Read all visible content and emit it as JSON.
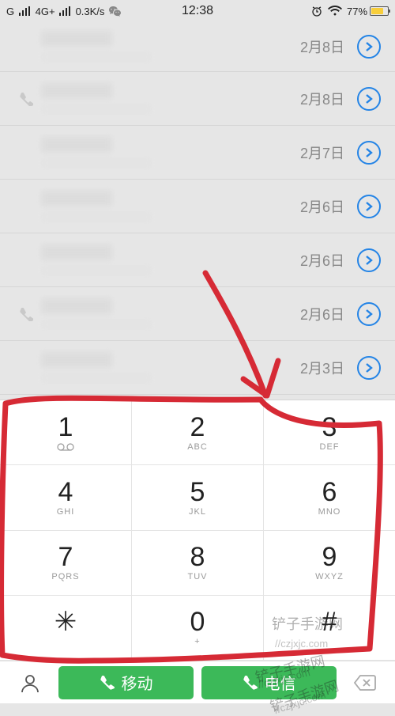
{
  "status": {
    "network": "G",
    "signal": "4G+",
    "speed": "0.3K/s",
    "time": "12:38",
    "battery_pct": "77%"
  },
  "calls": [
    {
      "date": "2月8日",
      "icon": "none"
    },
    {
      "date": "2月8日",
      "icon": "outgoing"
    },
    {
      "date": "2月7日",
      "icon": "none"
    },
    {
      "date": "2月6日",
      "icon": "none"
    },
    {
      "date": "2月6日",
      "icon": "none"
    },
    {
      "date": "2月6日",
      "icon": "outgoing"
    },
    {
      "date": "2月3日",
      "icon": "none"
    }
  ],
  "dialpad": [
    [
      {
        "num": "1",
        "sub": "voicemail"
      },
      {
        "num": "2",
        "sub": "ABC"
      },
      {
        "num": "3",
        "sub": "DEF"
      }
    ],
    [
      {
        "num": "4",
        "sub": "GHI"
      },
      {
        "num": "5",
        "sub": "JKL"
      },
      {
        "num": "6",
        "sub": "MNO"
      }
    ],
    [
      {
        "num": "7",
        "sub": "PQRS"
      },
      {
        "num": "8",
        "sub": "TUV"
      },
      {
        "num": "9",
        "sub": "WXYZ"
      }
    ],
    [
      {
        "num": "✳",
        "sub": ""
      },
      {
        "num": "0",
        "sub": "+"
      },
      {
        "num": "#",
        "sub": ""
      }
    ]
  ],
  "bottom": {
    "call_sim1": "移动",
    "call_sim2": "电信"
  },
  "watermark": {
    "brand": "铲子手游网",
    "url": "//czjxjc.com"
  }
}
